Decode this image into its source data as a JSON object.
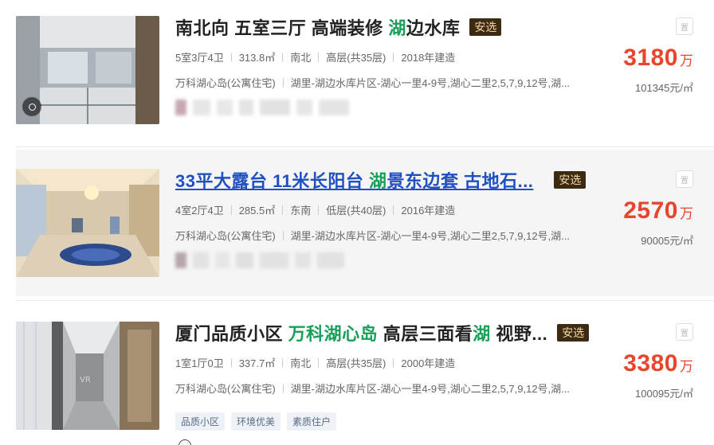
{
  "listings": [
    {
      "title_parts": [
        "南北向 五室三厅 高端装修 ",
        "湖",
        "边水库"
      ],
      "badge": "安选",
      "layout": "5室3厅4卫",
      "area": "313.8㎡",
      "orientation": "南北",
      "floor": "高层(共35层)",
      "year": "2018年建造",
      "community": "万科湖心岛(公寓住宅)",
      "address": "湖里-湖边水库片区-湖心一里4-9号,湖心二里2,5,7,9,12号,湖...",
      "price": "3180",
      "price_unit": "万",
      "unit_price": "101345元/㎡",
      "report_icon": "report-icon",
      "report_text": "置",
      "has_vr": true
    },
    {
      "title_parts": [
        "33平大露台 11米长阳台 ",
        "湖",
        "景东边套 古地石..."
      ],
      "badge": "安选",
      "layout": "4室2厅4卫",
      "area": "285.5㎡",
      "orientation": "东南",
      "floor": "低层(共40层)",
      "year": "2016年建造",
      "community": "万科湖心岛(公寓住宅)",
      "address": "湖里-湖边水库片区-湖心一里4-9号,湖心二里2,5,7,9,12号,湖...",
      "price": "2570",
      "price_unit": "万",
      "unit_price": "90005元/㎡",
      "report_icon": "report-icon",
      "report_text": "置",
      "has_vr": false
    },
    {
      "title_parts": [
        "厦门品质小区 ",
        "万科湖心岛",
        " 高层三面看",
        "湖",
        " 视野..."
      ],
      "badge": "安选",
      "layout": "1室1厅0卫",
      "area": "337.7㎡",
      "orientation": "南北",
      "floor": "高层(共35层)",
      "year": "2000年建造",
      "community": "万科湖心岛(公寓住宅)",
      "address": "湖里-湖边水库片区-湖心一里4-9号,湖心二里2,5,7,9,12号,湖...",
      "price": "3380",
      "price_unit": "万",
      "unit_price": "100095元/㎡",
      "tags": [
        "品质小区",
        "环境优美",
        "素质住户"
      ],
      "report_icon": "report-icon",
      "report_text": "置",
      "has_vr": false
    }
  ],
  "colors": {
    "price": "#e8462b",
    "highlight": "#18a058",
    "link_active": "#1f4fc1",
    "badge_bg": "#3d2a12",
    "badge_text": "#f3d8a6"
  }
}
